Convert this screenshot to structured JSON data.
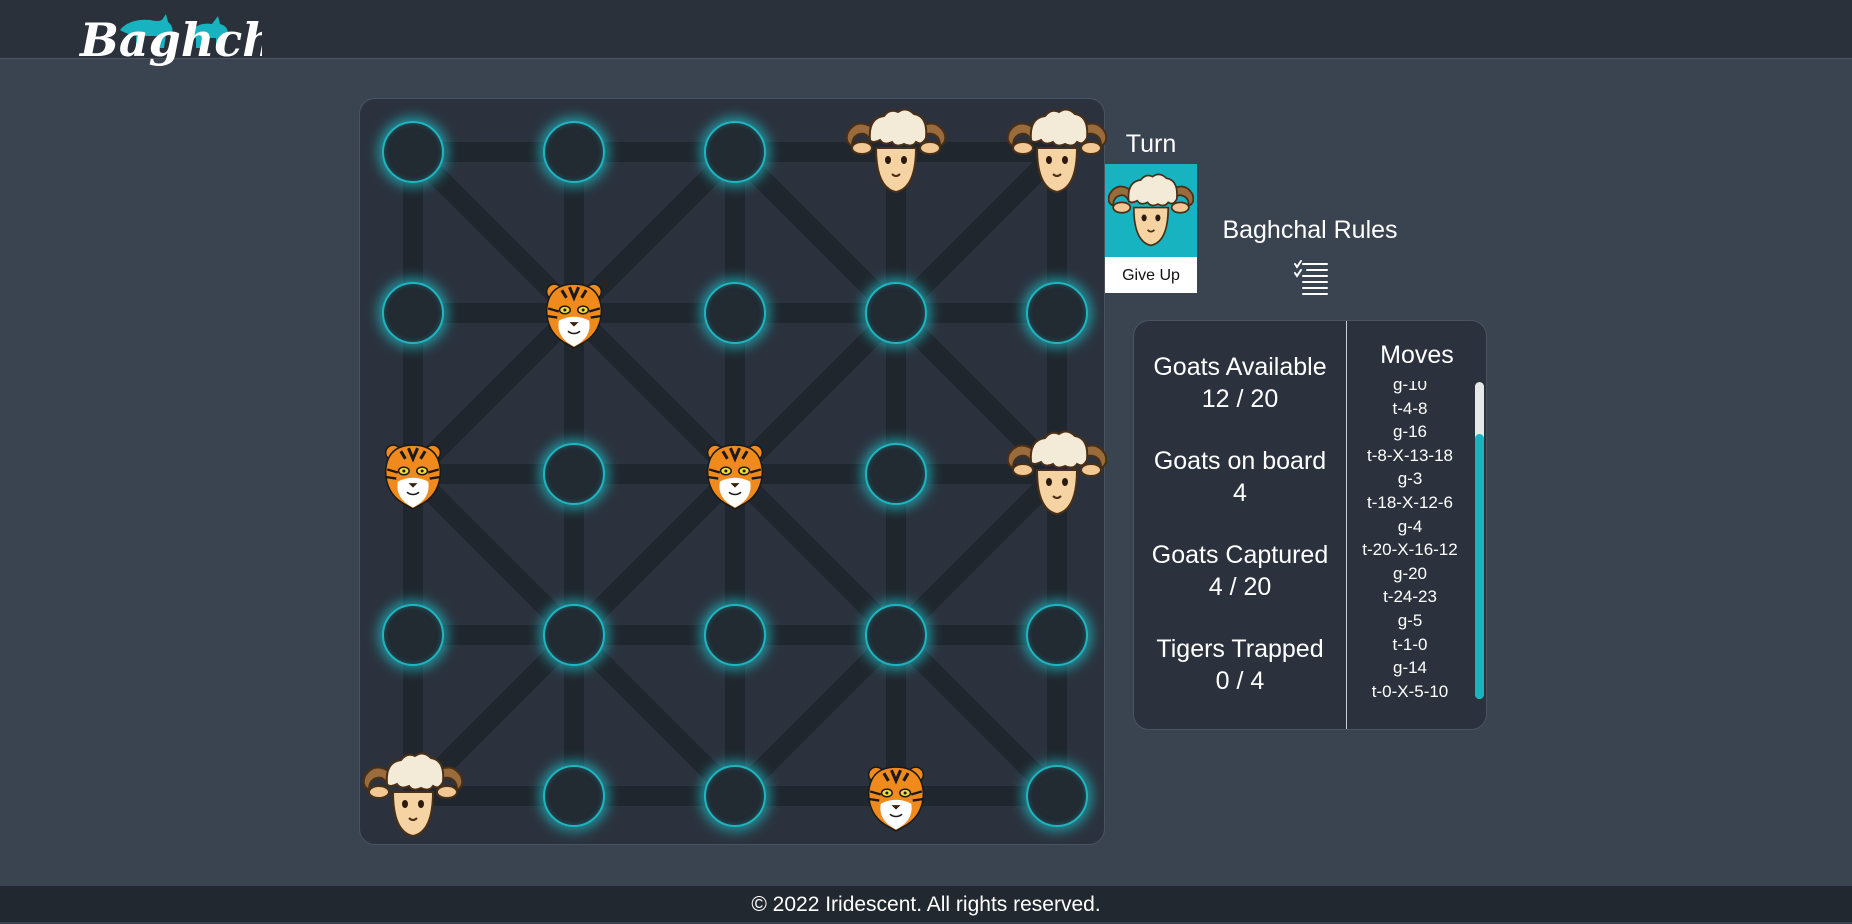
{
  "app": {
    "logo_text": "Baghchal"
  },
  "colors": {
    "accent": "#17b3c0",
    "background": "#3a4350",
    "board": "#2b323d",
    "header": "#2a313b",
    "footer": "#222830"
  },
  "board": {
    "pieces": [
      {
        "type": "goat",
        "icon": "goat-icon",
        "row": 0,
        "col": 3
      },
      {
        "type": "goat",
        "icon": "goat-icon",
        "row": 0,
        "col": 4
      },
      {
        "type": "tiger",
        "icon": "tiger-icon",
        "row": 1,
        "col": 1
      },
      {
        "type": "tiger",
        "icon": "tiger-icon",
        "row": 2,
        "col": 0
      },
      {
        "type": "tiger",
        "icon": "tiger-icon",
        "row": 2,
        "col": 2
      },
      {
        "type": "goat",
        "icon": "goat-icon",
        "row": 2,
        "col": 4
      },
      {
        "type": "goat",
        "icon": "goat-icon",
        "row": 4,
        "col": 0
      },
      {
        "type": "tiger",
        "icon": "tiger-icon",
        "row": 4,
        "col": 3
      }
    ]
  },
  "turn": {
    "label": "Turn",
    "current": "goat",
    "current_icon": "goat-icon",
    "give_up_label": "Give Up"
  },
  "rules": {
    "label": "Baghchal Rules",
    "icon": "checklist-icon"
  },
  "stats": {
    "goats_available": {
      "label": "Goats Available",
      "value": "12 / 20"
    },
    "goats_on_board": {
      "label": "Goats on board",
      "value": "4"
    },
    "goats_captured": {
      "label": "Goats Captured",
      "value": "4 / 20"
    },
    "tigers_trapped": {
      "label": "Tigers Trapped",
      "value": "0 / 4"
    }
  },
  "moves": {
    "title": "Moves",
    "list": [
      "g-10",
      "t-4-8",
      "g-16",
      "t-8-X-13-18",
      "g-3",
      "t-18-X-12-6",
      "g-4",
      "t-20-X-16-12",
      "g-20",
      "t-24-23",
      "g-5",
      "t-1-0",
      "g-14",
      "t-0-X-5-10"
    ],
    "scroll_position": 1.0
  },
  "footer": {
    "text": "© 2022 Iridescent. All rights reserved."
  }
}
